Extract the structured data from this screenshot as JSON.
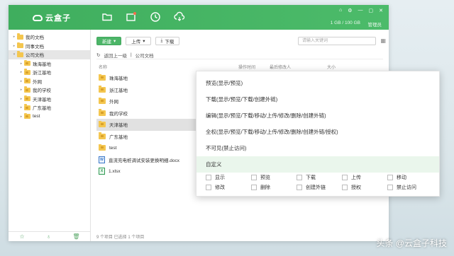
{
  "app": {
    "name": "云盒子"
  },
  "header": {
    "storage": "1 GB / 100 GB",
    "admin_label": "管理员"
  },
  "sidebar": {
    "items": [
      {
        "label": "我的文档",
        "level": 0
      },
      {
        "label": "同事文档",
        "level": 0
      },
      {
        "label": "公司文档",
        "level": 0,
        "selected": true
      },
      {
        "label": "珠海基地",
        "level": 1
      },
      {
        "label": "浙江基地",
        "level": 1
      },
      {
        "label": "外网",
        "level": 1
      },
      {
        "label": "我的学校",
        "level": 1
      },
      {
        "label": "天津基地",
        "level": 1
      },
      {
        "label": "广东基地",
        "level": 1
      },
      {
        "label": "test",
        "level": 1
      }
    ]
  },
  "toolbar": {
    "new_label": "新建",
    "upload_label": "上传",
    "download_label": "下载",
    "search_placeholder": "请输入关键词"
  },
  "breadcrumb": {
    "back": "返回上一级",
    "current": "公司文档"
  },
  "columns": {
    "name": "名称",
    "op_time": "操作时间",
    "last_modifier": "最后修改人",
    "size": "大小"
  },
  "files": [
    {
      "name": "珠海基地",
      "type": "folder"
    },
    {
      "name": "浙江基地",
      "type": "folder"
    },
    {
      "name": "外网",
      "type": "folder"
    },
    {
      "name": "我的学校",
      "type": "folder"
    },
    {
      "name": "天津基地",
      "type": "folder",
      "selected": true
    },
    {
      "name": "广东基地",
      "type": "folder"
    },
    {
      "name": "test",
      "type": "folder"
    },
    {
      "name": "直流充电桩调试安装更换明细.docx",
      "type": "doc"
    },
    {
      "name": "1.xlsx",
      "type": "xls"
    }
  ],
  "status": "9 个项目  已选择 1 个项目",
  "context_menu": {
    "items": [
      "预览(显示/预览)",
      "下载(显示/预览/下载/创建外链)",
      "编辑(显示/预览/下载/移动/上传/修改/删除/创建外链)",
      "全权(显示/预览/下载/移动/上传/修改/删除/创建外链/授权)",
      "不可见(禁止访问)",
      "自定义"
    ],
    "permissions": [
      "显示",
      "预览",
      "下载",
      "上传",
      "移动",
      "修改",
      "删除",
      "创建外链",
      "授权",
      "禁止访问"
    ]
  },
  "watermark": "头条 @云盒子科技",
  "colors": {
    "brand": "#4cb568",
    "selected_row": "#e1e1e1",
    "custom_highlight": "#eaf6ec"
  }
}
